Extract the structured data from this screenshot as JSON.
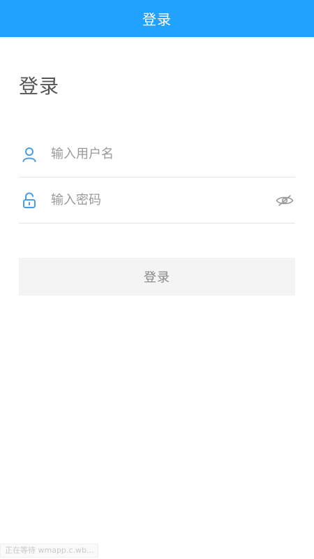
{
  "header": {
    "title": "登录"
  },
  "main": {
    "title": "登录",
    "username": {
      "placeholder": "输入用户名",
      "value": "",
      "icon": "user-icon"
    },
    "password": {
      "placeholder": "输入密码",
      "value": "",
      "icon": "unlock-icon",
      "toggle_icon": "eye-hidden-icon"
    },
    "submit_label": "登录"
  },
  "status": {
    "text": "正在等待 wmapp.c.wb..."
  },
  "colors": {
    "accent": "#22a2ff",
    "icon_blue": "#4a9be8",
    "button_bg": "#f4f4f4"
  }
}
